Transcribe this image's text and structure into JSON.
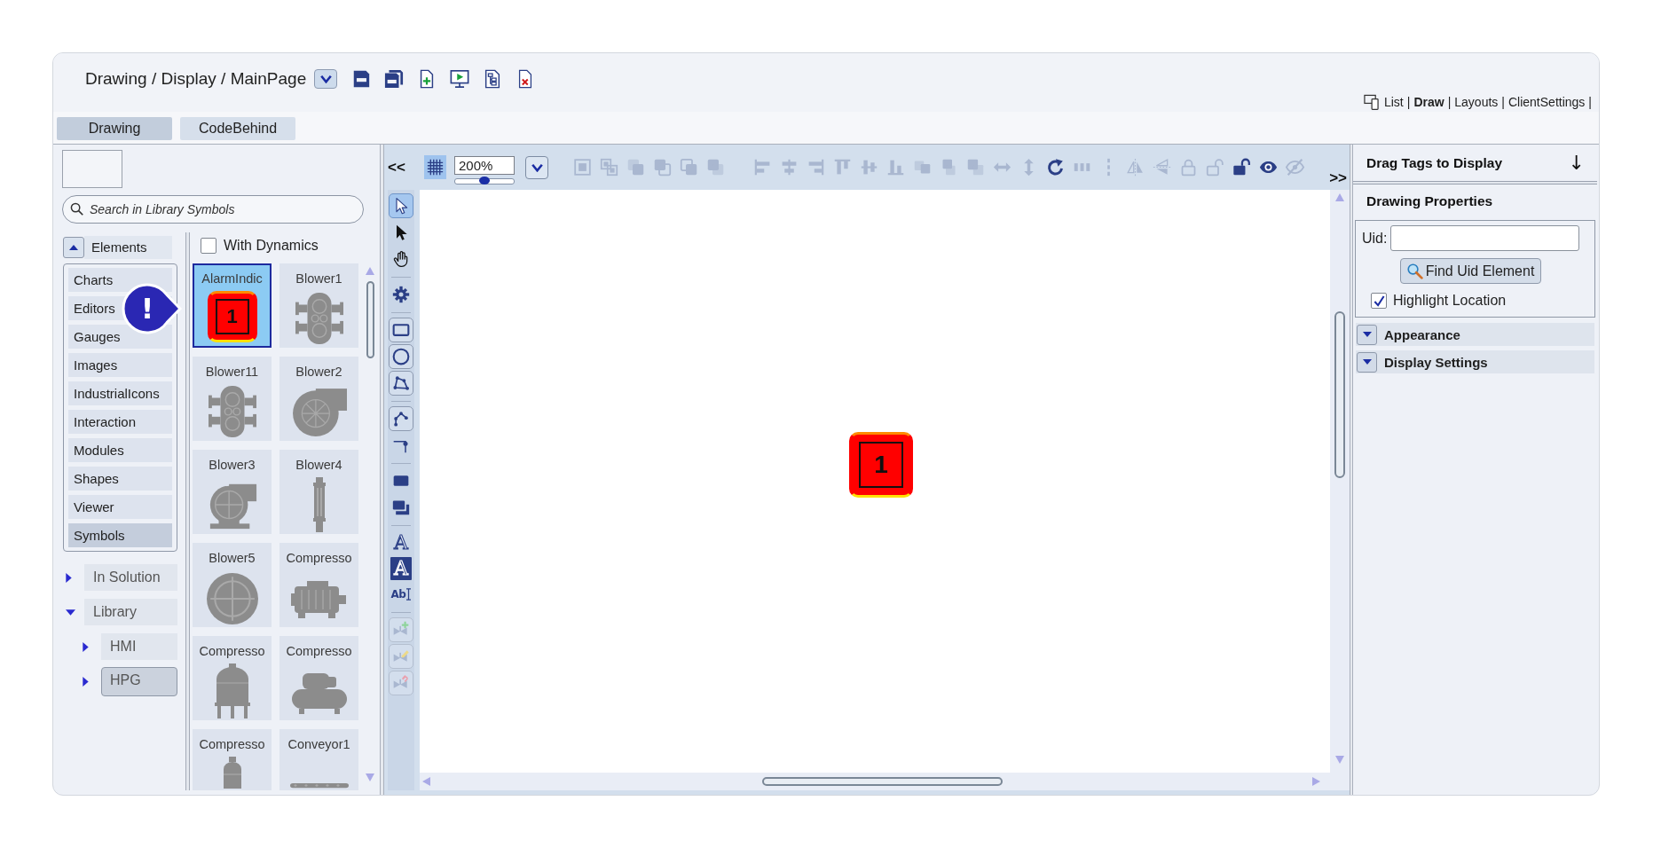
{
  "header": {
    "breadcrumb": "Drawing / Display / MainPage",
    "view_links": [
      {
        "label": "List",
        "selected": false,
        "separator": "|"
      },
      {
        "label": "Draw",
        "selected": true,
        "separator": "|"
      },
      {
        "label": "Layouts",
        "selected": false,
        "separator": "|"
      },
      {
        "label": "ClientSettings",
        "selected": false,
        "separator": "|"
      }
    ]
  },
  "tabs": [
    {
      "label": "Drawing",
      "selected": true
    },
    {
      "label": "CodeBehind",
      "selected": false
    }
  ],
  "library": {
    "search": {
      "placeholder": "Search in Library Symbols"
    },
    "elements": {
      "label": "Elements",
      "expanded": true,
      "items": [
        {
          "label": "Charts",
          "selected": false
        },
        {
          "label": "Editors",
          "selected": false
        },
        {
          "label": "Gauges",
          "selected": false
        },
        {
          "label": "Images",
          "selected": false
        },
        {
          "label": "IndustrialIcons",
          "selected": false
        },
        {
          "label": "Interaction",
          "selected": false
        },
        {
          "label": "Modules",
          "selected": false
        },
        {
          "label": "Shapes",
          "selected": false
        },
        {
          "label": "Viewer",
          "selected": false
        },
        {
          "label": "Symbols",
          "selected": true
        }
      ]
    },
    "tree": [
      {
        "label": "In Solution",
        "expanded": false,
        "selected": false
      },
      {
        "label": "Library",
        "expanded": true,
        "selected": false,
        "children": [
          {
            "label": "HMI",
            "expanded": false,
            "selected": false
          },
          {
            "label": "HPG",
            "expanded": false,
            "selected": true
          }
        ]
      }
    ]
  },
  "symbols": {
    "with_dynamics": {
      "label": "With Dynamics",
      "checked": false
    },
    "items": [
      {
        "label": "AlarmIndic",
        "kind": "alarm",
        "selected": true,
        "value": "1"
      },
      {
        "label": "Blower1",
        "kind": "blowerinline",
        "selected": false
      },
      {
        "label": "Blower11",
        "kind": "blowerinline",
        "selected": false
      },
      {
        "label": "Blower2",
        "kind": "blowerradial",
        "selected": false
      },
      {
        "label": "Blower3",
        "kind": "blowermotor",
        "selected": false
      },
      {
        "label": "Blower4",
        "kind": "blowercolumn",
        "selected": false
      },
      {
        "label": "Blower5",
        "kind": "fan",
        "selected": false
      },
      {
        "label": "Compresso",
        "kind": "motor",
        "selected": false
      },
      {
        "label": "Compresso",
        "kind": "tank",
        "selected": false
      },
      {
        "label": "Compresso",
        "kind": "portable",
        "selected": false
      },
      {
        "label": "Compresso",
        "kind": "column",
        "selected": false
      },
      {
        "label": "Conveyor1",
        "kind": "conveyor",
        "selected": false
      }
    ]
  },
  "callout": {
    "text": "!"
  },
  "canvas": {
    "collapse": "<<",
    "expand": ">>",
    "grid": {
      "on": true
    },
    "zoom": {
      "value": "200%",
      "level": 0.5
    },
    "tool_groups": [
      {
        "tools": [
          {
            "kind": "group",
            "disabled": true
          },
          {
            "kind": "ungroup",
            "disabled": true
          },
          {
            "kind": "front",
            "disabled": true
          },
          {
            "kind": "back",
            "disabled": true
          },
          {
            "kind": "forward",
            "disabled": true
          },
          {
            "kind": "backward",
            "disabled": true
          }
        ]
      },
      {
        "tools": [
          {
            "kind": "alignleft",
            "disabled": true
          },
          {
            "kind": "aligncenter",
            "disabled": true
          },
          {
            "kind": "alignright",
            "disabled": true
          },
          {
            "kind": "aligntop",
            "disabled": true
          },
          {
            "kind": "alignmiddle",
            "disabled": true
          },
          {
            "kind": "alignbottom",
            "disabled": true
          },
          {
            "kind": "samewidth",
            "disabled": true
          },
          {
            "kind": "sameheight",
            "disabled": true
          },
          {
            "kind": "samesize",
            "disabled": true
          },
          {
            "kind": "spreadx",
            "disabled": true
          },
          {
            "kind": "spready",
            "disabled": true
          },
          {
            "kind": "rotate",
            "disabled": false
          },
          {
            "kind": "distribute",
            "disabled": true
          },
          {
            "kind": "dashes",
            "disabled": true
          },
          {
            "kind": "fliph",
            "disabled": true
          },
          {
            "kind": "flipv",
            "disabled": true
          },
          {
            "kind": "lock",
            "disabled": true
          },
          {
            "kind": "unlock",
            "disabled": true
          },
          {
            "kind": "unlocksolid",
            "disabled": false
          },
          {
            "kind": "show",
            "disabled": false
          },
          {
            "kind": "hide",
            "disabled": true
          }
        ]
      }
    ],
    "side_tool_groups": [
      {
        "tools": [
          {
            "kind": "select",
            "selected": true,
            "disabled": false
          },
          {
            "kind": "pointer",
            "selected": false,
            "disabled": false
          },
          {
            "kind": "pan",
            "selected": false,
            "disabled": false
          }
        ]
      },
      {
        "tools": [
          {
            "kind": "settings",
            "selected": false,
            "disabled": false
          }
        ]
      },
      {
        "tools": [
          {
            "kind": "rectangle",
            "selected": false,
            "disabled": false
          },
          {
            "kind": "ellipse",
            "selected": false,
            "disabled": false
          },
          {
            "kind": "polygon",
            "selected": false,
            "disabled": false
          }
        ]
      },
      {
        "tools": [
          {
            "kind": "polyline",
            "selected": false,
            "disabled": false
          },
          {
            "kind": "connector",
            "selected": false,
            "disabled": false
          }
        ]
      },
      {
        "tools": [
          {
            "kind": "button",
            "selected": false,
            "disabled": false
          },
          {
            "kind": "panel",
            "selected": false,
            "disabled": false
          }
        ]
      },
      {
        "tools": [
          {
            "kind": "text",
            "glyph": "A",
            "selected": false,
            "disabled": false
          },
          {
            "kind": "textinverse",
            "glyph": "A",
            "selected": false,
            "disabled": false
          },
          {
            "kind": "textbox",
            "glyph": "Ab",
            "selected": false,
            "disabled": false
          }
        ]
      },
      {
        "tools": [
          {
            "kind": "addsymbol",
            "selected": false,
            "disabled": true
          },
          {
            "kind": "editsymbol",
            "selected": false,
            "disabled": true
          },
          {
            "kind": "linksymbol",
            "selected": false,
            "disabled": true
          }
        ]
      }
    ],
    "element": {
      "kind": "alarm",
      "value": "1"
    }
  },
  "properties": {
    "drag_tags": {
      "label": "Drag Tags to Display",
      "arrow": "↓"
    },
    "title": "Drawing Properties",
    "uid": {
      "label": "Uid:"
    },
    "find_button": "Find Uid Element",
    "highlight": {
      "label": "Highlight Location",
      "checked": true
    },
    "sections": [
      {
        "label": "Appearance",
        "expanded": false
      },
      {
        "label": "Display Settings",
        "expanded": false
      }
    ]
  }
}
